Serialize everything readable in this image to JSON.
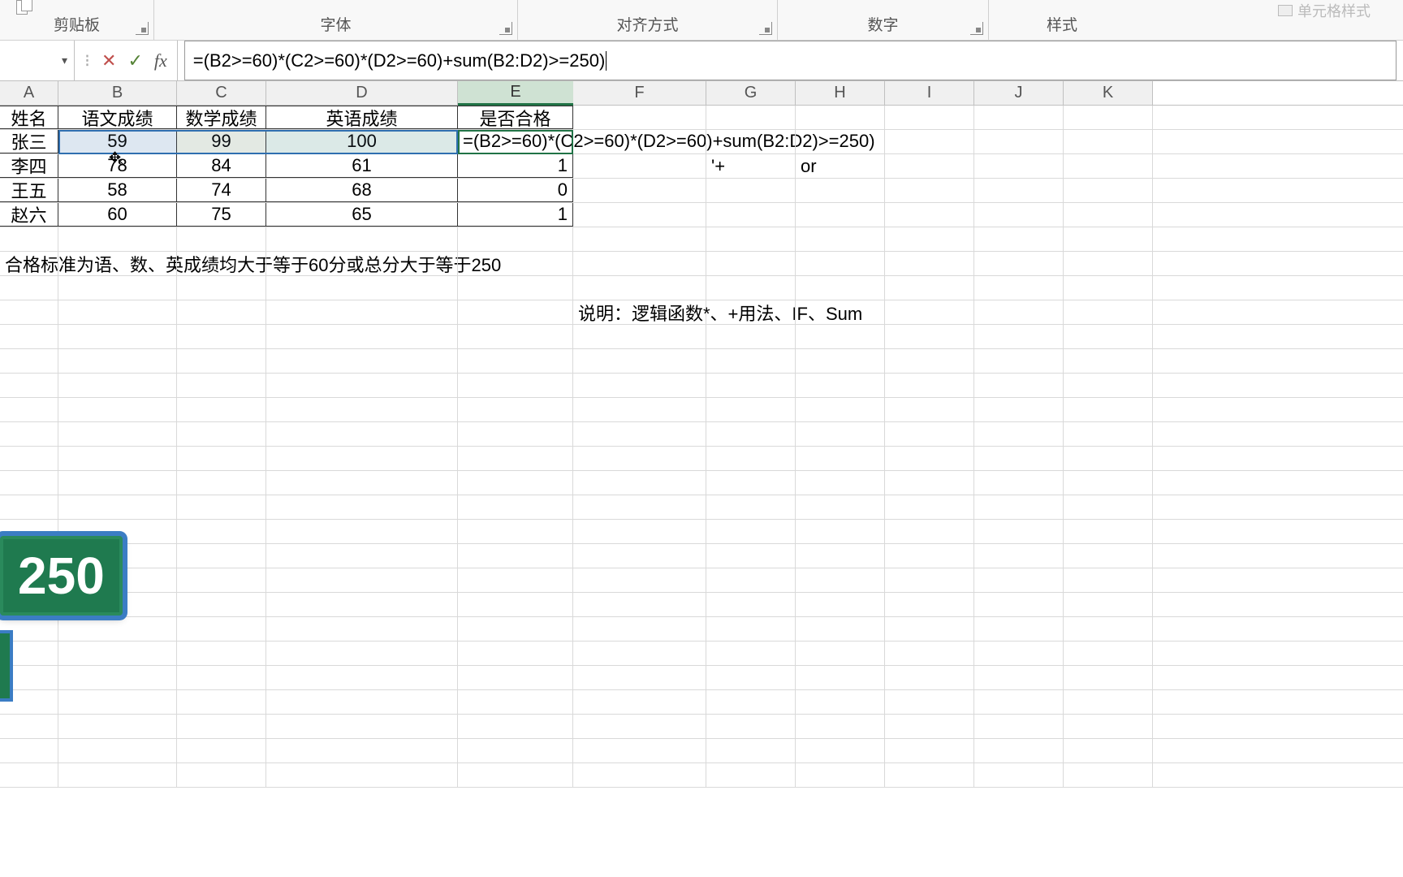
{
  "ribbon": {
    "clipboard": "剪贴板",
    "font": "字体",
    "alignment": "对齐方式",
    "number": "数字",
    "styles": "样式",
    "disabled_btn": "单元格样式"
  },
  "formula_bar": {
    "formula": "=(B2>=60)*(C2>=60)*(D2>=60)+sum(B2:D2)>=250)"
  },
  "columns": [
    "A",
    "B",
    "C",
    "D",
    "E",
    "F",
    "G",
    "H",
    "I",
    "J",
    "K"
  ],
  "headers": {
    "A": "姓名",
    "B": "语文成绩",
    "C": "数学成绩",
    "D": "英语成绩",
    "E": "是否合格"
  },
  "data_rows": [
    {
      "A": "张三",
      "B": "59",
      "C": "99",
      "D": "100",
      "E": "=(B2>=60)*(C2>=60)*(D2>=60)+sum(B2:D2)>=250)"
    },
    {
      "A": "李四",
      "B": "78",
      "C": "84",
      "D": "61",
      "E": "1",
      "G": "'+",
      "H": "or"
    },
    {
      "A": "王五",
      "B": "58",
      "C": "74",
      "D": "68",
      "E": "0"
    },
    {
      "A": "赵六",
      "B": "60",
      "C": "75",
      "D": "65",
      "E": "1"
    }
  ],
  "note_text": "合格标准为语、数、英成绩均大于等于60分或总分大于等于250",
  "explain_text": "说明：逻辑函数*、+用法、IF、Sum",
  "callout": "250"
}
